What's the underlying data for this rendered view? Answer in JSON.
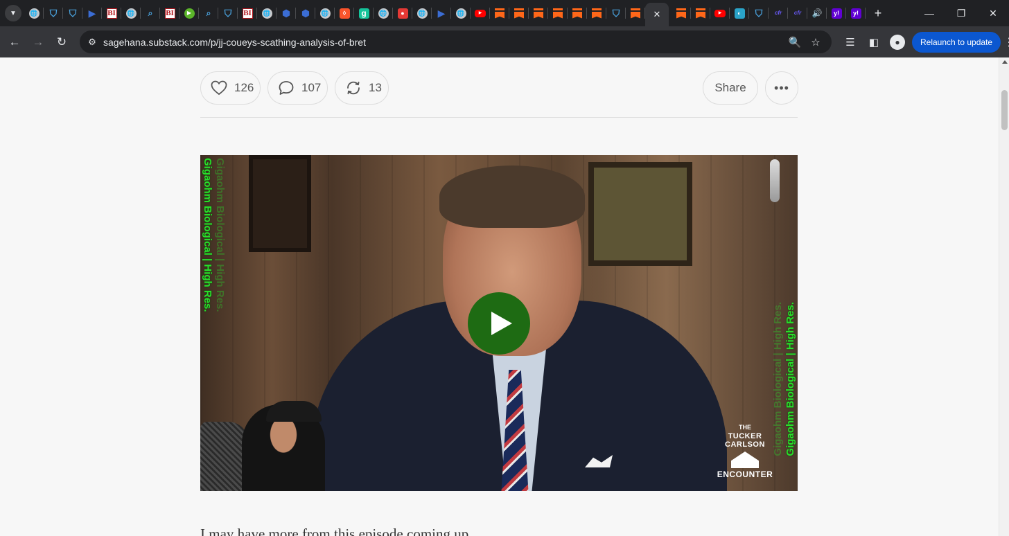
{
  "browser": {
    "tabs": [
      {
        "icon": "globe-icon",
        "glyph": "🌐"
      },
      {
        "icon": "shield-icon",
        "glyph": "⛉"
      },
      {
        "icon": "shield-icon",
        "glyph": "⛉"
      },
      {
        "icon": "arrow-icon",
        "glyph": "▶"
      },
      {
        "icon": "bi-icon",
        "glyph": "BI"
      },
      {
        "icon": "globe-icon",
        "glyph": "🌐"
      },
      {
        "icon": "magnifier-icon",
        "glyph": "⌕"
      },
      {
        "icon": "bi-icon",
        "glyph": "BI"
      },
      {
        "icon": "play-circle-icon",
        "glyph": "▶"
      },
      {
        "icon": "magnifier-icon",
        "glyph": "⌕"
      },
      {
        "icon": "shield-icon",
        "glyph": "⛉"
      },
      {
        "icon": "bi-icon",
        "glyph": "BI"
      },
      {
        "icon": "globe-icon",
        "glyph": "🌐"
      },
      {
        "icon": "gear-icon",
        "glyph": "⬢"
      },
      {
        "icon": "gear-icon",
        "glyph": "⬢"
      },
      {
        "icon": "globe-icon",
        "glyph": "🌐"
      },
      {
        "icon": "brave-icon",
        "glyph": "◊"
      },
      {
        "icon": "g-icon",
        "glyph": "g"
      },
      {
        "icon": "globe-icon",
        "glyph": "🌐"
      },
      {
        "icon": "microphone-icon",
        "glyph": "●"
      },
      {
        "icon": "globe-icon",
        "glyph": "🌐"
      },
      {
        "icon": "arrow-icon",
        "glyph": "▶"
      },
      {
        "icon": "globe-icon",
        "glyph": "🌐"
      },
      {
        "icon": "youtube-icon",
        "glyph": "▶"
      },
      {
        "icon": "substack-icon",
        "glyph": ""
      },
      {
        "icon": "substack-icon",
        "glyph": ""
      },
      {
        "icon": "substack-icon",
        "glyph": ""
      },
      {
        "icon": "substack-icon",
        "glyph": ""
      },
      {
        "icon": "substack-icon",
        "glyph": ""
      },
      {
        "icon": "substack-icon",
        "glyph": ""
      },
      {
        "icon": "shield-icon",
        "glyph": "⛉"
      },
      {
        "icon": "substack-icon",
        "glyph": ""
      }
    ],
    "tabs_after": [
      {
        "icon": "substack-icon",
        "glyph": ""
      },
      {
        "icon": "substack-icon",
        "glyph": ""
      },
      {
        "icon": "youtube-icon",
        "glyph": "▶"
      },
      {
        "icon": "tc-icon",
        "glyph": "◐"
      },
      {
        "icon": "shield-icon",
        "glyph": "⛉"
      },
      {
        "icon": "cfr-icon",
        "glyph": "cfr"
      },
      {
        "icon": "cfr-icon",
        "glyph": "cfr"
      },
      {
        "icon": "speaker-icon",
        "glyph": "🔊"
      },
      {
        "icon": "yahoo-icon",
        "glyph": "y!"
      },
      {
        "icon": "yahoo-icon",
        "glyph": "y!"
      }
    ],
    "active_tab_close": "✕",
    "new_tab": "+",
    "url_host": "sagehana.substack.com",
    "url_path": "/p/jj-coueys-scathing-analysis-of-bret",
    "relaunch_label": "Relaunch to update"
  },
  "post": {
    "likes": "126",
    "comments": "107",
    "restacks": "13",
    "share_label": "Share",
    "more_label": "•••",
    "video": {
      "watermark": "Gigaohm Biological | High Res.",
      "show_the": "THE",
      "show_name": "TUCKER CARLSON",
      "show_enc": "ENCOUNTER"
    },
    "body_text": "I may have more from this episode coming up"
  }
}
